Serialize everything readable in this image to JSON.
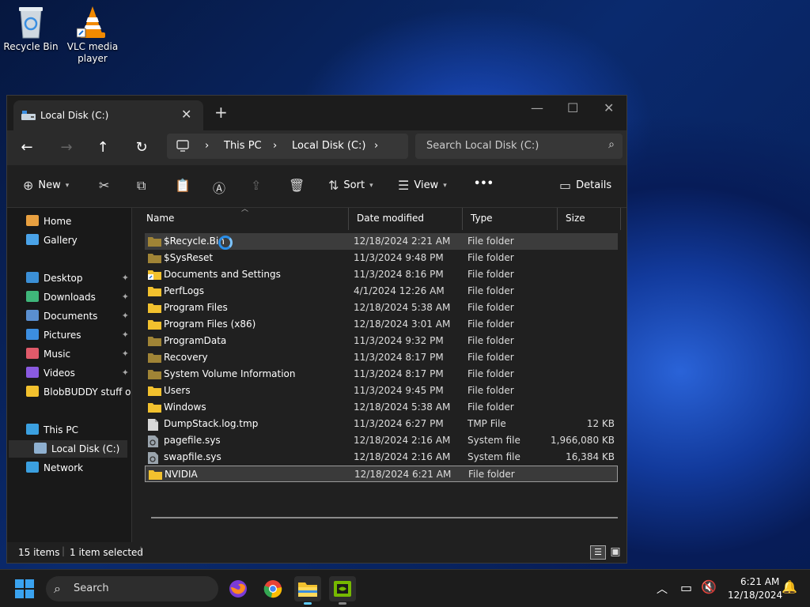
{
  "desktop": {
    "icons": [
      {
        "label": "Recycle Bin",
        "icon": "recycle-bin-icon"
      },
      {
        "label": "VLC media player",
        "icon": "vlc-icon"
      }
    ]
  },
  "window": {
    "tab_title": "Local Disk (C:)",
    "tab_close": "✕",
    "new_tab": "+",
    "controls": {
      "minimize": "—",
      "maximize": "☐",
      "close": "✕"
    }
  },
  "nav": {
    "back": "←",
    "forward": "→",
    "up": "↑",
    "refresh": "↻",
    "breadcrumb": [
      "This PC",
      "Local Disk (C:)"
    ],
    "search_placeholder": "Search Local Disk (C:)"
  },
  "toolbar": {
    "new_label": "New",
    "sort_label": "Sort",
    "view_label": "View",
    "more_label": "•••",
    "details_label": "Details"
  },
  "sidebar": {
    "items": [
      {
        "label": "Home",
        "icon": "home-icon",
        "color": "#e8a040"
      },
      {
        "label": "Gallery",
        "icon": "gallery-icon",
        "color": "#4aa3e8"
      },
      {
        "label": "Desktop",
        "icon": "desktop-folder-icon",
        "color": "#3b8fd6",
        "pinned": true
      },
      {
        "label": "Downloads",
        "icon": "downloads-icon",
        "color": "#3fb67a",
        "pinned": true
      },
      {
        "label": "Documents",
        "icon": "documents-icon",
        "color": "#5a8fd0",
        "pinned": true
      },
      {
        "label": "Pictures",
        "icon": "pictures-icon",
        "color": "#3c8ee0",
        "pinned": true
      },
      {
        "label": "Music",
        "icon": "music-icon",
        "color": "#e05a6a",
        "pinned": true
      },
      {
        "label": "Videos",
        "icon": "videos-icon",
        "color": "#8a5ae0",
        "pinned": true
      },
      {
        "label": "BlobBUDDY stuff or s",
        "icon": "folder-icon",
        "color": "#f2c12e"
      },
      {
        "label": "This PC",
        "icon": "this-pc-icon",
        "color": "#3ba0e0"
      },
      {
        "label": "Local Disk (C:)",
        "icon": "local-disk-icon",
        "color": "#8fb0d0"
      },
      {
        "label": "Network",
        "icon": "network-icon",
        "color": "#3ba0e0"
      }
    ],
    "pin_glyph": "📌"
  },
  "columns": {
    "name": "Name",
    "date": "Date modified",
    "type": "Type",
    "size": "Size"
  },
  "files": [
    {
      "name": "$Recycle.Bin",
      "date": "12/18/2024 2:21 AM",
      "type": "File folder",
      "size": "",
      "kind": "folder-dim"
    },
    {
      "name": "$SysReset",
      "date": "11/3/2024 9:48 PM",
      "type": "File folder",
      "size": "",
      "kind": "folder-dim"
    },
    {
      "name": "Documents and Settings",
      "date": "11/3/2024 8:16 PM",
      "type": "File folder",
      "size": "",
      "kind": "folder-link"
    },
    {
      "name": "PerfLogs",
      "date": "4/1/2024 12:26 AM",
      "type": "File folder",
      "size": "",
      "kind": "folder"
    },
    {
      "name": "Program Files",
      "date": "12/18/2024 5:38 AM",
      "type": "File folder",
      "size": "",
      "kind": "folder"
    },
    {
      "name": "Program Files (x86)",
      "date": "12/18/2024 3:01 AM",
      "type": "File folder",
      "size": "",
      "kind": "folder"
    },
    {
      "name": "ProgramData",
      "date": "11/3/2024 9:32 PM",
      "type": "File folder",
      "size": "",
      "kind": "folder-dim"
    },
    {
      "name": "Recovery",
      "date": "11/3/2024 8:17 PM",
      "type": "File folder",
      "size": "",
      "kind": "folder-dim"
    },
    {
      "name": "System Volume Information",
      "date": "11/3/2024 8:17 PM",
      "type": "File folder",
      "size": "",
      "kind": "folder-dim"
    },
    {
      "name": "Users",
      "date": "11/3/2024 9:45 PM",
      "type": "File folder",
      "size": "",
      "kind": "folder"
    },
    {
      "name": "Windows",
      "date": "12/18/2024 5:38 AM",
      "type": "File folder",
      "size": "",
      "kind": "folder"
    },
    {
      "name": "DumpStack.log.tmp",
      "date": "11/3/2024 6:27 PM",
      "type": "TMP File",
      "size": "12 KB",
      "kind": "file"
    },
    {
      "name": "pagefile.sys",
      "date": "12/18/2024 2:16 AM",
      "type": "System file",
      "size": "1,966,080 KB",
      "kind": "sysfile"
    },
    {
      "name": "swapfile.sys",
      "date": "12/18/2024 2:16 AM",
      "type": "System file",
      "size": "16,384 KB",
      "kind": "sysfile"
    },
    {
      "name": "NVIDIA",
      "date": "12/18/2024 6:21 AM",
      "type": "File folder",
      "size": "",
      "kind": "folder"
    }
  ],
  "status": {
    "count": "15 items",
    "selected": "1 item selected"
  },
  "taskbar": {
    "search_label": "Search",
    "time": "6:21 AM",
    "date": "12/18/2024",
    "apps": [
      "firefox-icon",
      "chrome-icon",
      "file-explorer-icon",
      "nvidia-icon"
    ]
  },
  "colors": {
    "accent": "#0078d4",
    "folder": "#f2c12e",
    "folder_dim": "#a08436",
    "selection_border": "#9a9a9a"
  }
}
